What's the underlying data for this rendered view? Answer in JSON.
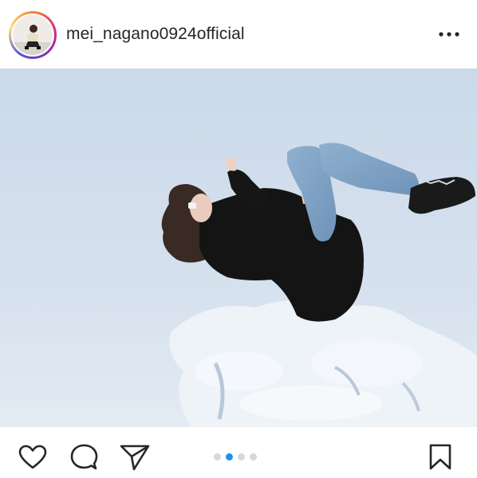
{
  "post": {
    "username": "mei_nagano0924official",
    "avatar": "profile-photo",
    "more_icon": "more-horizontal-icon",
    "photo_description": "",
    "carousel": {
      "count": 4,
      "active_index": 1
    }
  },
  "actions": {
    "like_icon": "heart-icon",
    "comment_icon": "comment-icon",
    "share_icon": "send-icon",
    "save_icon": "bookmark-icon"
  },
  "colors": {
    "text": "#262626",
    "active_dot": "#1e90e8",
    "inactive_dot": "#d8d8d8",
    "story_ring": [
      "#f58529",
      "#dd2a7b",
      "#8134af",
      "#515bd4"
    ]
  }
}
